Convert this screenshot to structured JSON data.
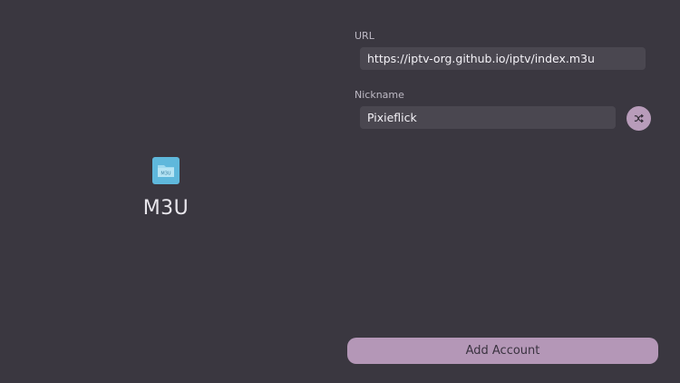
{
  "provider": {
    "title": "M3U",
    "icon": "m3u-folder-icon",
    "icon_text": "M3U",
    "icon_color": "#5fb8dc"
  },
  "form": {
    "url": {
      "label": "URL",
      "value": "https://iptv-org.github.io/iptv/index.m3u"
    },
    "nickname": {
      "label": "Nickname",
      "value": "Pixieflick"
    },
    "shuffle_icon": "shuffle-icon"
  },
  "actions": {
    "add_account_label": "Add Account"
  },
  "colors": {
    "background": "#3a3740",
    "input_background": "#4a4750",
    "accent": "#b497b7"
  }
}
